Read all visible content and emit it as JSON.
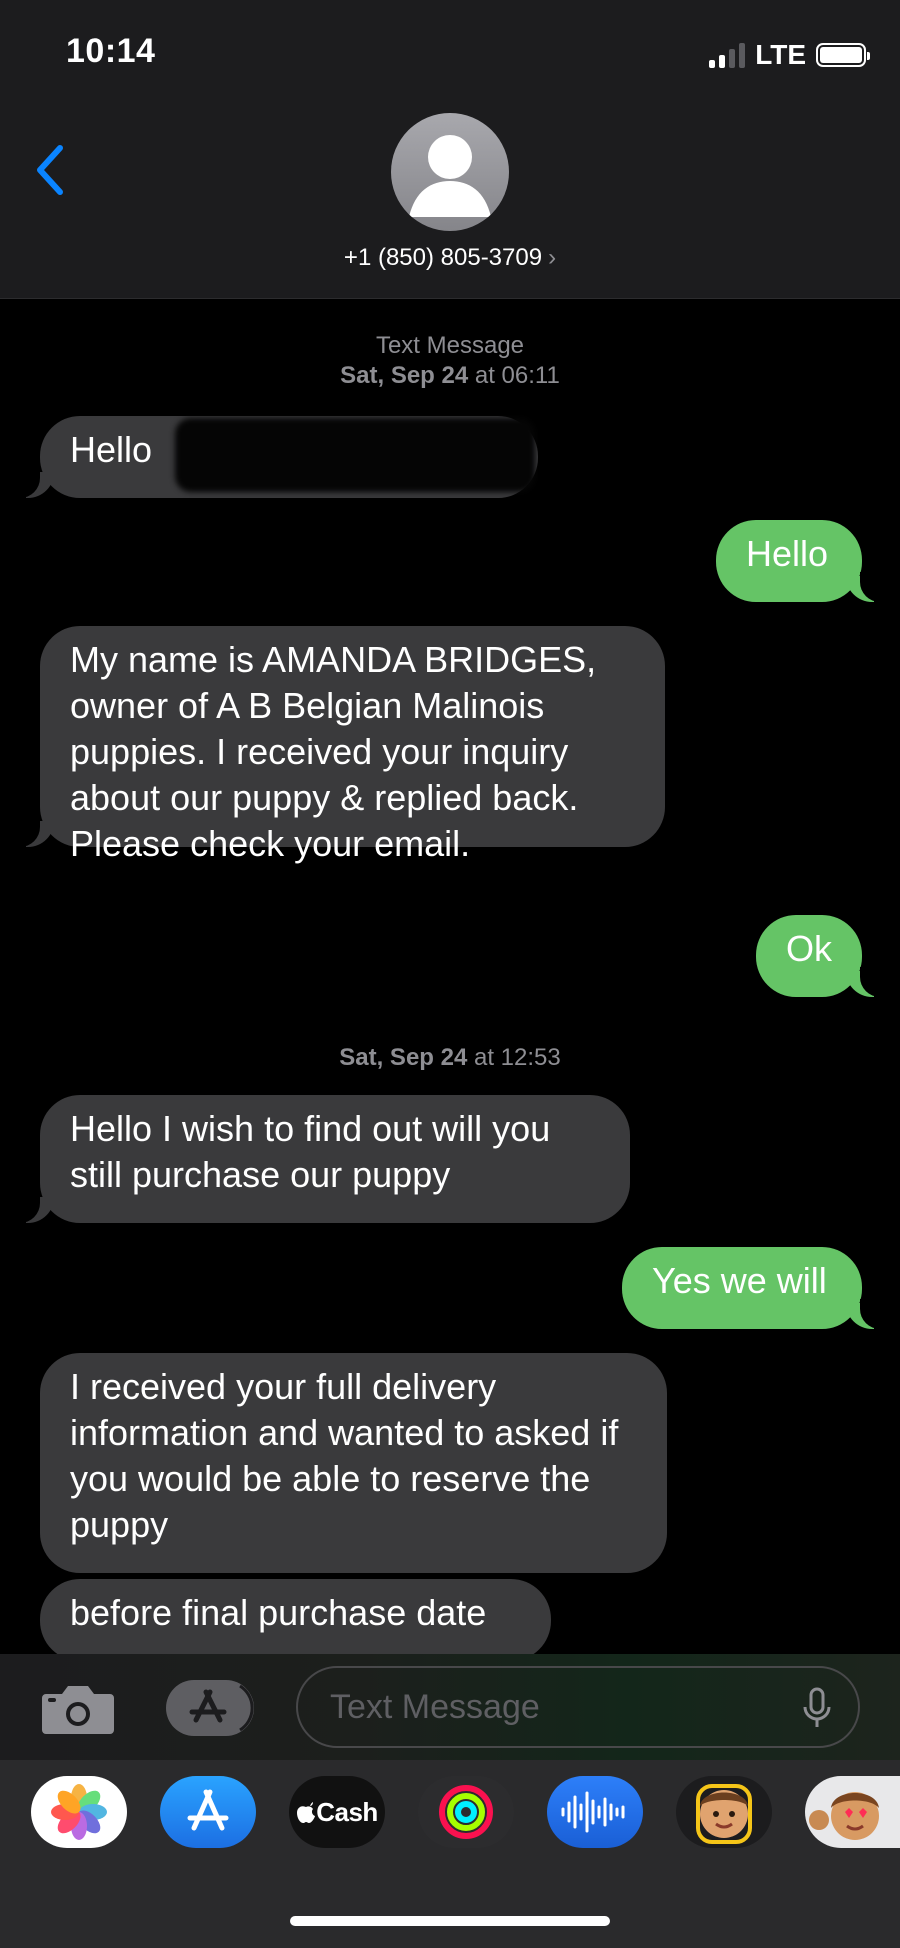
{
  "status_bar": {
    "time": "10:14",
    "network": "LTE"
  },
  "header": {
    "contact": "+1 (850) 805-3709",
    "chevron": "›"
  },
  "thread": {
    "service_label": "Text Message",
    "stamp1_day": "Sat, Sep 24",
    "stamp1_time": "at 06:11",
    "stamp2_day": "Sat, Sep 24",
    "stamp2_time": "at 12:53",
    "messages": [
      {
        "dir": "in",
        "text": "Hello"
      },
      {
        "dir": "out",
        "text": "Hello"
      },
      {
        "dir": "in",
        "text": "My name is AMANDA  BRIDGES, owner of A B Belgian Malinois puppies. I received your inquiry about our puppy & replied back. Please check your email."
      },
      {
        "dir": "out",
        "text": "Ok"
      },
      {
        "dir": "in",
        "text": "Hello I wish to find out will you still purchase our puppy"
      },
      {
        "dir": "out",
        "text": "Yes we will"
      },
      {
        "dir": "in",
        "text": "I received your full delivery information and wanted to asked if you would be able to reserve the puppy"
      },
      {
        "dir": "in",
        "text": "before final purchase date"
      }
    ]
  },
  "input": {
    "placeholder": "Text Message"
  },
  "drawer": {
    "apps": [
      "photos-icon",
      "app-store-icon",
      "apple-cash-icon",
      "activity-icon",
      "voice-memo-icon",
      "memoji-icon",
      "animoji-icon"
    ],
    "cash_label": "Cash"
  },
  "colors": {
    "incoming": "#3a3a3c",
    "outgoing": "#65c466",
    "accent": "#0a84ff"
  }
}
